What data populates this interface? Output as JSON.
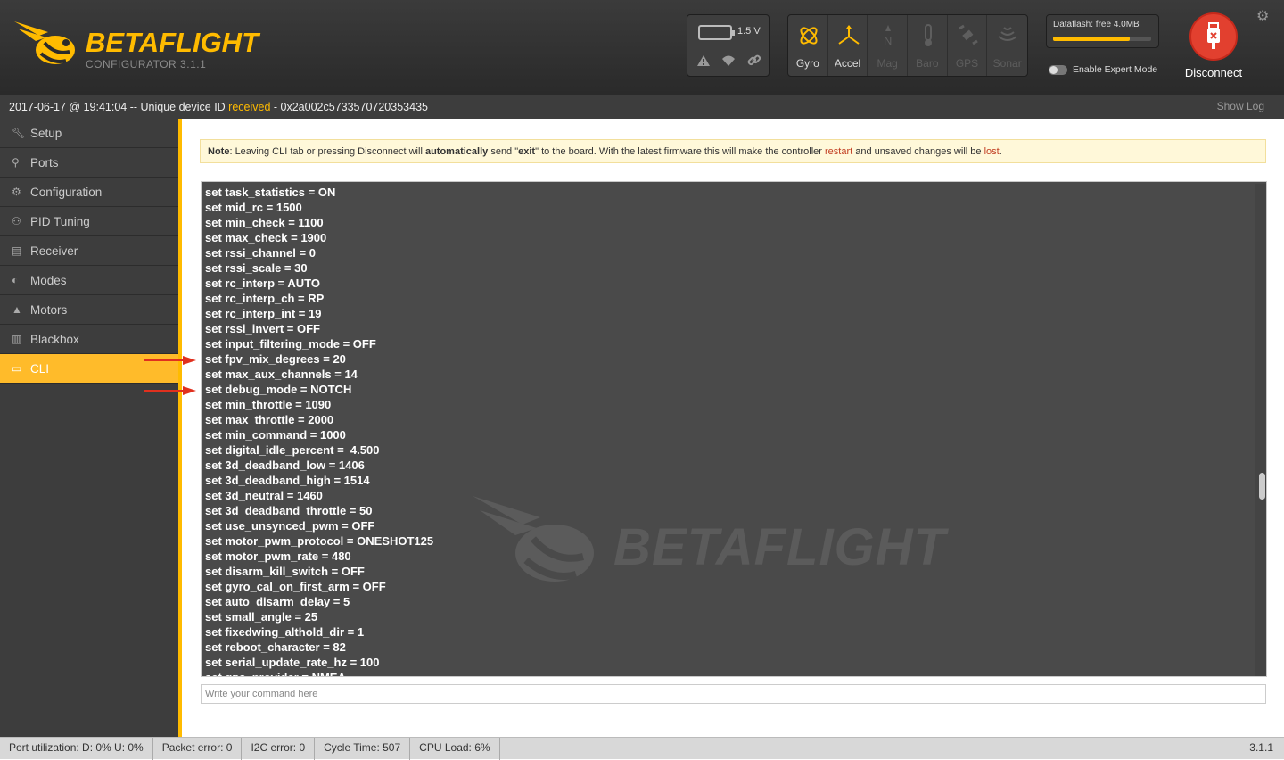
{
  "header": {
    "brand": "BETAFLIGHT",
    "brand_sub": "CONFIGURATOR  3.1.1",
    "battery_voltage": "1.5 V",
    "sensors": [
      {
        "label": "Gyro",
        "icon": "gyro-icon",
        "active": true
      },
      {
        "label": "Accel",
        "icon": "accel-icon",
        "active": true
      },
      {
        "label": "Mag",
        "icon": "mag-icon",
        "active": false
      },
      {
        "label": "Baro",
        "icon": "baro-icon",
        "active": false
      },
      {
        "label": "GPS",
        "icon": "gps-icon",
        "active": false
      },
      {
        "label": "Sonar",
        "icon": "sonar-icon",
        "active": false
      }
    ],
    "dataflash_text": "Dataflash: free 4.0MB",
    "dataflash_used_fraction": 0.78,
    "expert_mode_label": "Enable Expert Mode",
    "disconnect_label": "Disconnect"
  },
  "log": {
    "prefix": "2017-06-17 @ 19:41:04 -- Unique device ID ",
    "received": "received",
    "suffix": " - 0x2a002c5733570720353435",
    "show_log": "Show Log"
  },
  "sidebar": {
    "items": [
      {
        "label": "Setup",
        "icon": "wrench-icon",
        "active": false
      },
      {
        "label": "Ports",
        "icon": "plug-icon",
        "active": false
      },
      {
        "label": "Configuration",
        "icon": "gear-icon",
        "active": false
      },
      {
        "label": "PID Tuning",
        "icon": "tree-icon",
        "active": false
      },
      {
        "label": "Receiver",
        "icon": "receiver-icon",
        "active": false
      },
      {
        "label": "Modes",
        "icon": "toggle-icon",
        "active": false
      },
      {
        "label": "Motors",
        "icon": "motor-icon",
        "active": false
      },
      {
        "label": "Blackbox",
        "icon": "blackbox-icon",
        "active": false
      },
      {
        "label": "CLI",
        "icon": "window-icon",
        "active": true
      }
    ]
  },
  "note": {
    "t1": "Note",
    "t2": ": Leaving CLI tab or pressing Disconnect will ",
    "t3": "automatically",
    "t4": " send \"",
    "t5": "exit",
    "t6": "\" to the board. With the latest firmware this will make the controller ",
    "t7": "restart",
    "t8": " and unsaved changes will be ",
    "t9": "lost",
    "t10": "."
  },
  "cli": {
    "watermark": "BETAFLIGHT",
    "lines": [
      "set task_statistics = ON",
      "set mid_rc = 1500",
      "set min_check = 1100",
      "set max_check = 1900",
      "set rssi_channel = 0",
      "set rssi_scale = 30",
      "set rc_interp = AUTO",
      "set rc_interp_ch = RP",
      "set rc_interp_int = 19",
      "set rssi_invert = OFF",
      "set input_filtering_mode = OFF",
      "set fpv_mix_degrees = 20",
      "set max_aux_channels = 14",
      "set debug_mode = NOTCH",
      "set min_throttle = 1090",
      "set max_throttle = 2000",
      "set min_command = 1000",
      "set digital_idle_percent =  4.500",
      "set 3d_deadband_low = 1406",
      "set 3d_deadband_high = 1514",
      "set 3d_neutral = 1460",
      "set 3d_deadband_throttle = 50",
      "set use_unsynced_pwm = OFF",
      "set motor_pwm_protocol = ONESHOT125",
      "set motor_pwm_rate = 480",
      "set disarm_kill_switch = OFF",
      "set gyro_cal_on_first_arm = OFF",
      "set auto_disarm_delay = 5",
      "set small_angle = 25",
      "set fixedwing_althold_dir = 1",
      "set reboot_character = 82",
      "set serial_update_rate_hz = 100",
      "set gps_provider = NMEA"
    ],
    "command_placeholder": "Write your command here"
  },
  "footer": {
    "port_util": "Port utilization: D: 0% U: 0%",
    "packet_error": "Packet error: 0",
    "i2c_error": "I2C error: 0",
    "cycle_time": "Cycle Time: 507",
    "cpu_load": "CPU Load: 6%",
    "version": "3.1.1"
  },
  "colors": {
    "accent": "#ffbb00",
    "disconnect": "#e2402f",
    "arrow": "#e0301e"
  }
}
